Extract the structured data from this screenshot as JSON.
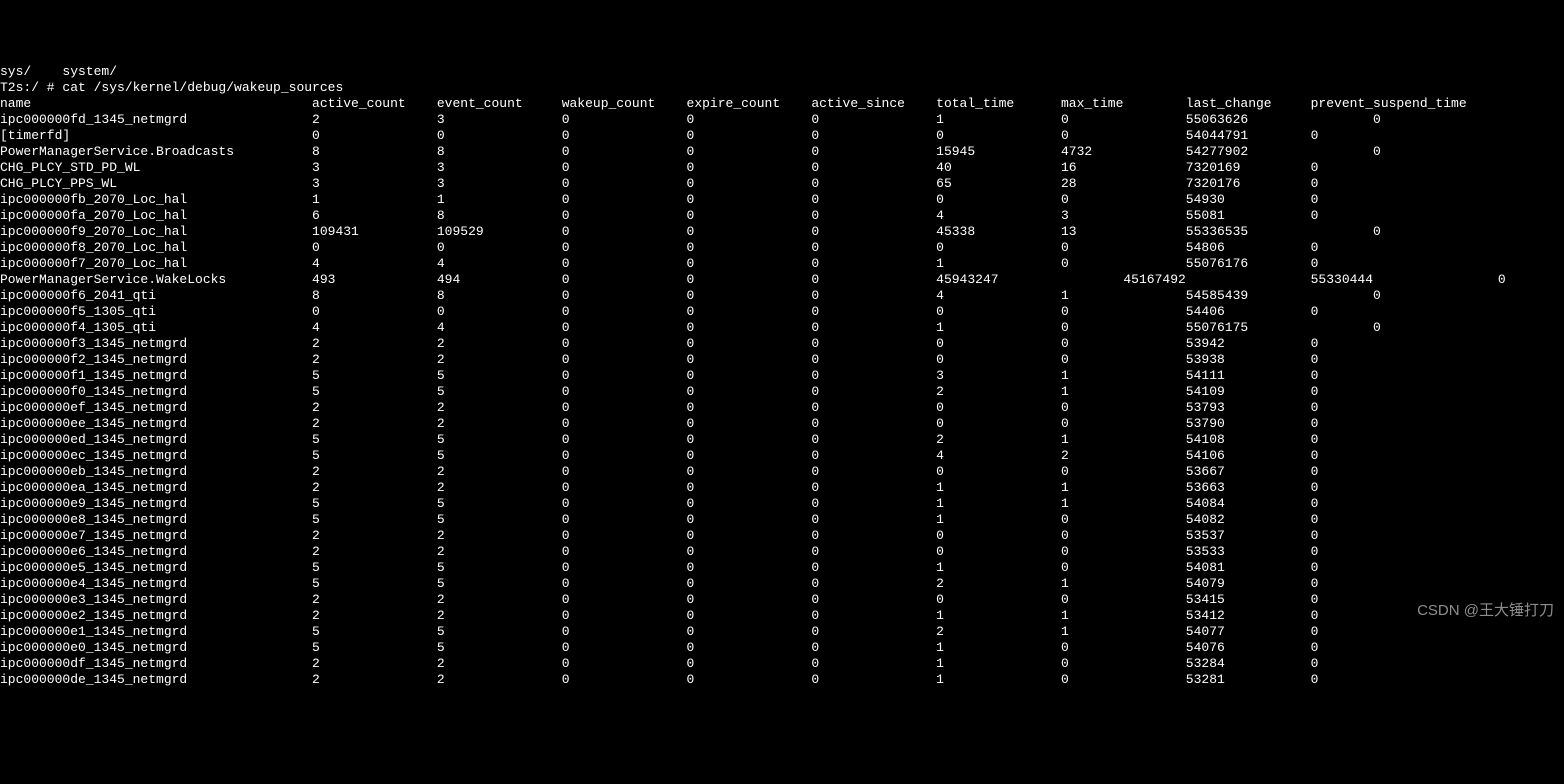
{
  "header_line": "sys/    system/",
  "prompt_line": "T2s:/ # cat /sys/kernel/debug/wakeup_sources",
  "columns": [
    "name",
    "active_count",
    "event_count",
    "wakeup_count",
    "expire_count",
    "active_since",
    "total_time",
    "max_time",
    "last_change",
    "prevent_suspend_time"
  ],
  "rows": [
    {
      "name": "ipc000000fd_1345_netmgrd",
      "active_count": "2",
      "event_count": "3",
      "wakeup_count": "0",
      "expire_count": "0",
      "active_since": "0",
      "total_time": "1",
      "max_time": "0",
      "last_change": "55063626",
      "prevent_suspend_time": "0",
      "pst_col": 9
    },
    {
      "name": "[timerfd]",
      "active_count": "0",
      "event_count": "0",
      "wakeup_count": "0",
      "expire_count": "0",
      "active_since": "0",
      "total_time": "0",
      "max_time": "0",
      "last_change": "54044791",
      "prevent_suspend_time": "0",
      "pst_col": 8
    },
    {
      "name": "PowerManagerService.Broadcasts",
      "active_count": "8",
      "event_count": "8",
      "wakeup_count": "0",
      "expire_count": "0",
      "active_since": "0",
      "total_time": "15945",
      "max_time": "4732",
      "last_change": "54277902",
      "prevent_suspend_time": "0",
      "pst_col": 9
    },
    {
      "name": "CHG_PLCY_STD_PD_WL",
      "active_count": "3",
      "event_count": "3",
      "wakeup_count": "0",
      "expire_count": "0",
      "active_since": "0",
      "total_time": "40",
      "max_time": "16",
      "last_change": "7320169",
      "prevent_suspend_time": "0",
      "pst_col": 8
    },
    {
      "name": "CHG_PLCY_PPS_WL",
      "active_count": "3",
      "event_count": "3",
      "wakeup_count": "0",
      "expire_count": "0",
      "active_since": "0",
      "total_time": "65",
      "max_time": "28",
      "last_change": "7320176",
      "prevent_suspend_time": "0",
      "pst_col": 8
    },
    {
      "name": "ipc000000fb_2070_Loc_hal",
      "active_count": "1",
      "event_count": "1",
      "wakeup_count": "0",
      "expire_count": "0",
      "active_since": "0",
      "total_time": "0",
      "max_time": "0",
      "last_change": "54930",
      "prevent_suspend_time": "0",
      "pst_col": 8
    },
    {
      "name": "ipc000000fa_2070_Loc_hal",
      "active_count": "6",
      "event_count": "8",
      "wakeup_count": "0",
      "expire_count": "0",
      "active_since": "0",
      "total_time": "4",
      "max_time": "3",
      "last_change": "55081",
      "prevent_suspend_time": "0",
      "pst_col": 8
    },
    {
      "name": "ipc000000f9_2070_Loc_hal",
      "active_count": "109431",
      "event_count": "109529",
      "wakeup_count": "0",
      "expire_count": "0",
      "active_since": "0",
      "total_time": "45338",
      "max_time": "13",
      "last_change": "55336535",
      "prevent_suspend_time": "0",
      "pst_col": 9
    },
    {
      "name": "ipc000000f8_2070_Loc_hal",
      "active_count": "0",
      "event_count": "0",
      "wakeup_count": "0",
      "expire_count": "0",
      "active_since": "0",
      "total_time": "0",
      "max_time": "0",
      "last_change": "54806",
      "prevent_suspend_time": "0",
      "pst_col": 8
    },
    {
      "name": "ipc000000f7_2070_Loc_hal",
      "active_count": "4",
      "event_count": "4",
      "wakeup_count": "0",
      "expire_count": "0",
      "active_since": "0",
      "total_time": "1",
      "max_time": "0",
      "last_change": "55076176",
      "prevent_suspend_time": "0",
      "pst_col": 8
    },
    {
      "name": "PowerManagerService.WakeLocks",
      "active_count": "493",
      "event_count": "494",
      "wakeup_count": "0",
      "expire_count": "0",
      "active_since": "0",
      "total_time": "45943247",
      "max_time": "45167492",
      "last_change": "55330444",
      "prevent_suspend_time": "0",
      "pst_col": 10,
      "special": true
    },
    {
      "name": "ipc000000f6_2041_qti",
      "active_count": "8",
      "event_count": "8",
      "wakeup_count": "0",
      "expire_count": "0",
      "active_since": "0",
      "total_time": "4",
      "max_time": "1",
      "last_change": "54585439",
      "prevent_suspend_time": "0",
      "pst_col": 9
    },
    {
      "name": "ipc000000f5_1305_qti",
      "active_count": "0",
      "event_count": "0",
      "wakeup_count": "0",
      "expire_count": "0",
      "active_since": "0",
      "total_time": "0",
      "max_time": "0",
      "last_change": "54406",
      "prevent_suspend_time": "0",
      "pst_col": 8
    },
    {
      "name": "ipc000000f4_1305_qti",
      "active_count": "4",
      "event_count": "4",
      "wakeup_count": "0",
      "expire_count": "0",
      "active_since": "0",
      "total_time": "1",
      "max_time": "0",
      "last_change": "55076175",
      "prevent_suspend_time": "0",
      "pst_col": 9
    },
    {
      "name": "ipc000000f3_1345_netmgrd",
      "active_count": "2",
      "event_count": "2",
      "wakeup_count": "0",
      "expire_count": "0",
      "active_since": "0",
      "total_time": "0",
      "max_time": "0",
      "last_change": "53942",
      "prevent_suspend_time": "0",
      "pst_col": 8
    },
    {
      "name": "ipc000000f2_1345_netmgrd",
      "active_count": "2",
      "event_count": "2",
      "wakeup_count": "0",
      "expire_count": "0",
      "active_since": "0",
      "total_time": "0",
      "max_time": "0",
      "last_change": "53938",
      "prevent_suspend_time": "0",
      "pst_col": 8
    },
    {
      "name": "ipc000000f1_1345_netmgrd",
      "active_count": "5",
      "event_count": "5",
      "wakeup_count": "0",
      "expire_count": "0",
      "active_since": "0",
      "total_time": "3",
      "max_time": "1",
      "last_change": "54111",
      "prevent_suspend_time": "0",
      "pst_col": 8
    },
    {
      "name": "ipc000000f0_1345_netmgrd",
      "active_count": "5",
      "event_count": "5",
      "wakeup_count": "0",
      "expire_count": "0",
      "active_since": "0",
      "total_time": "2",
      "max_time": "1",
      "last_change": "54109",
      "prevent_suspend_time": "0",
      "pst_col": 8
    },
    {
      "name": "ipc000000ef_1345_netmgrd",
      "active_count": "2",
      "event_count": "2",
      "wakeup_count": "0",
      "expire_count": "0",
      "active_since": "0",
      "total_time": "0",
      "max_time": "0",
      "last_change": "53793",
      "prevent_suspend_time": "0",
      "pst_col": 8
    },
    {
      "name": "ipc000000ee_1345_netmgrd",
      "active_count": "2",
      "event_count": "2",
      "wakeup_count": "0",
      "expire_count": "0",
      "active_since": "0",
      "total_time": "0",
      "max_time": "0",
      "last_change": "53790",
      "prevent_suspend_time": "0",
      "pst_col": 8
    },
    {
      "name": "ipc000000ed_1345_netmgrd",
      "active_count": "5",
      "event_count": "5",
      "wakeup_count": "0",
      "expire_count": "0",
      "active_since": "0",
      "total_time": "2",
      "max_time": "1",
      "last_change": "54108",
      "prevent_suspend_time": "0",
      "pst_col": 8
    },
    {
      "name": "ipc000000ec_1345_netmgrd",
      "active_count": "5",
      "event_count": "5",
      "wakeup_count": "0",
      "expire_count": "0",
      "active_since": "0",
      "total_time": "4",
      "max_time": "2",
      "last_change": "54106",
      "prevent_suspend_time": "0",
      "pst_col": 8
    },
    {
      "name": "ipc000000eb_1345_netmgrd",
      "active_count": "2",
      "event_count": "2",
      "wakeup_count": "0",
      "expire_count": "0",
      "active_since": "0",
      "total_time": "0",
      "max_time": "0",
      "last_change": "53667",
      "prevent_suspend_time": "0",
      "pst_col": 8
    },
    {
      "name": "ipc000000ea_1345_netmgrd",
      "active_count": "2",
      "event_count": "2",
      "wakeup_count": "0",
      "expire_count": "0",
      "active_since": "0",
      "total_time": "1",
      "max_time": "1",
      "last_change": "53663",
      "prevent_suspend_time": "0",
      "pst_col": 8
    },
    {
      "name": "ipc000000e9_1345_netmgrd",
      "active_count": "5",
      "event_count": "5",
      "wakeup_count": "0",
      "expire_count": "0",
      "active_since": "0",
      "total_time": "1",
      "max_time": "1",
      "last_change": "54084",
      "prevent_suspend_time": "0",
      "pst_col": 8
    },
    {
      "name": "ipc000000e8_1345_netmgrd",
      "active_count": "5",
      "event_count": "5",
      "wakeup_count": "0",
      "expire_count": "0",
      "active_since": "0",
      "total_time": "1",
      "max_time": "0",
      "last_change": "54082",
      "prevent_suspend_time": "0",
      "pst_col": 8
    },
    {
      "name": "ipc000000e7_1345_netmgrd",
      "active_count": "2",
      "event_count": "2",
      "wakeup_count": "0",
      "expire_count": "0",
      "active_since": "0",
      "total_time": "0",
      "max_time": "0",
      "last_change": "53537",
      "prevent_suspend_time": "0",
      "pst_col": 8
    },
    {
      "name": "ipc000000e6_1345_netmgrd",
      "active_count": "2",
      "event_count": "2",
      "wakeup_count": "0",
      "expire_count": "0",
      "active_since": "0",
      "total_time": "0",
      "max_time": "0",
      "last_change": "53533",
      "prevent_suspend_time": "0",
      "pst_col": 8
    },
    {
      "name": "ipc000000e5_1345_netmgrd",
      "active_count": "5",
      "event_count": "5",
      "wakeup_count": "0",
      "expire_count": "0",
      "active_since": "0",
      "total_time": "1",
      "max_time": "0",
      "last_change": "54081",
      "prevent_suspend_time": "0",
      "pst_col": 8
    },
    {
      "name": "ipc000000e4_1345_netmgrd",
      "active_count": "5",
      "event_count": "5",
      "wakeup_count": "0",
      "expire_count": "0",
      "active_since": "0",
      "total_time": "2",
      "max_time": "1",
      "last_change": "54079",
      "prevent_suspend_time": "0",
      "pst_col": 8
    },
    {
      "name": "ipc000000e3_1345_netmgrd",
      "active_count": "2",
      "event_count": "2",
      "wakeup_count": "0",
      "expire_count": "0",
      "active_since": "0",
      "total_time": "0",
      "max_time": "0",
      "last_change": "53415",
      "prevent_suspend_time": "0",
      "pst_col": 8
    },
    {
      "name": "ipc000000e2_1345_netmgrd",
      "active_count": "2",
      "event_count": "2",
      "wakeup_count": "0",
      "expire_count": "0",
      "active_since": "0",
      "total_time": "1",
      "max_time": "1",
      "last_change": "53412",
      "prevent_suspend_time": "0",
      "pst_col": 8
    },
    {
      "name": "ipc000000e1_1345_netmgrd",
      "active_count": "5",
      "event_count": "5",
      "wakeup_count": "0",
      "expire_count": "0",
      "active_since": "0",
      "total_time": "2",
      "max_time": "1",
      "last_change": "54077",
      "prevent_suspend_time": "0",
      "pst_col": 8
    },
    {
      "name": "ipc000000e0_1345_netmgrd",
      "active_count": "5",
      "event_count": "5",
      "wakeup_count": "0",
      "expire_count": "0",
      "active_since": "0",
      "total_time": "1",
      "max_time": "0",
      "last_change": "54076",
      "prevent_suspend_time": "0",
      "pst_col": 8
    },
    {
      "name": "ipc000000df_1345_netmgrd",
      "active_count": "2",
      "event_count": "2",
      "wakeup_count": "0",
      "expire_count": "0",
      "active_since": "0",
      "total_time": "1",
      "max_time": "0",
      "last_change": "53284",
      "prevent_suspend_time": "0",
      "pst_col": 8
    },
    {
      "name": "ipc000000de_1345_netmgrd",
      "active_count": "2",
      "event_count": "2",
      "wakeup_count": "0",
      "expire_count": "0",
      "active_since": "0",
      "total_time": "1",
      "max_time": "0",
      "last_change": "53281",
      "prevent_suspend_time": "0",
      "pst_col": 8
    }
  ],
  "watermark": "CSDN @王大锤打刀"
}
